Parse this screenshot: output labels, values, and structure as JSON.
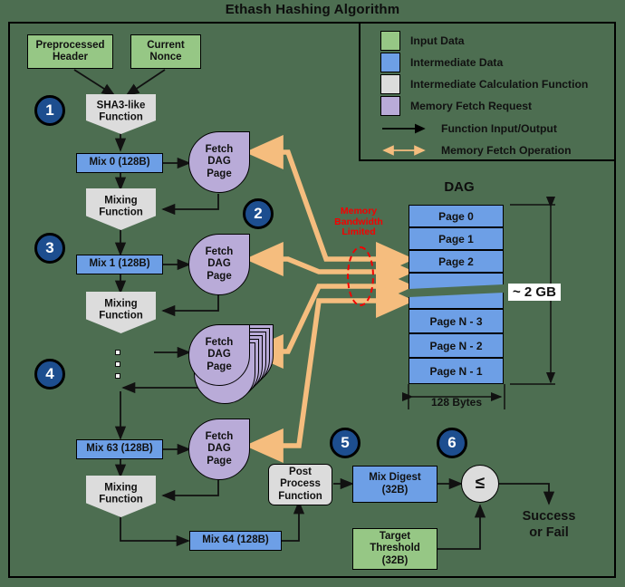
{
  "title": "Ethash Hashing Algorithm",
  "colors": {
    "background": "#4d6e51",
    "input_data": "#96c785",
    "intermediate_data": "#6d9fe6",
    "calculation_function": "#dcdcdc",
    "memory_fetch_request": "#b9abd8",
    "memory_fetch_arrow": "#f5bd7e",
    "badge": "#1d4e8f",
    "warning_text": "#f40000"
  },
  "legend": {
    "swatches": [
      {
        "name": "input-data",
        "label": "Input Data",
        "color": "#96c785"
      },
      {
        "name": "intermediate-data",
        "label": "Intermediate Data",
        "color": "#6d9fe6"
      },
      {
        "name": "intermediate-calculation-function",
        "label": "Intermediate Calculation Function",
        "color": "#dcdcdc"
      },
      {
        "name": "memory-fetch-request",
        "label": "Memory Fetch Request",
        "color": "#b9abd8"
      }
    ],
    "lines": [
      {
        "name": "function-input-output",
        "label": "Function Input/Output",
        "color": "#000000",
        "arrows": "single"
      },
      {
        "name": "memory-fetch-operation",
        "label": "Memory Fetch Operation",
        "color": "#f5bd7e",
        "arrows": "double"
      }
    ]
  },
  "nodes": {
    "preprocessed_header": "Preprocessed\nHeader",
    "preprocessed_header_l1": "Preprocessed",
    "preprocessed_header_l2": "Header",
    "current_nonce_l1": "Current",
    "current_nonce_l2": "Nonce",
    "sha3_l1": "SHA3-like",
    "sha3_l2": "Function",
    "mix0": "Mix 0 (128B)",
    "mix1": "Mix 1 (128B)",
    "mix63": "Mix 63 (128B)",
    "mix64": "Mix 64 (128B)",
    "mixing_l1": "Mixing",
    "mixing_l2": "Function",
    "fetch_l1": "Fetch",
    "fetch_l2": "DAG",
    "fetch_l3": "Page",
    "post_process_l1": "Post",
    "post_process_l2": "Process",
    "post_process_l3": "Function",
    "mix_digest_l1": "Mix Digest",
    "mix_digest_l2": "(32B)",
    "target_threshold_l1": "Target",
    "target_threshold_l2": "Threshold",
    "target_threshold_l3": "(32B)",
    "compare_op": "≤",
    "result_l1": "Success",
    "result_l2": "or Fail"
  },
  "badges": [
    "1",
    "2",
    "3",
    "4",
    "5",
    "6"
  ],
  "dag": {
    "title": "DAG",
    "pages": [
      "Page 0",
      "Page 1",
      "Page 2",
      "Page N - 3",
      "Page N - 2",
      "Page N - 1"
    ],
    "size_label": "~ 2 GB",
    "width_label": "128 Bytes"
  },
  "annotations": {
    "memory_bandwidth_l1": "Memory",
    "memory_bandwidth_l2": "Bandwidth",
    "memory_bandwidth_l3": "Limited"
  }
}
